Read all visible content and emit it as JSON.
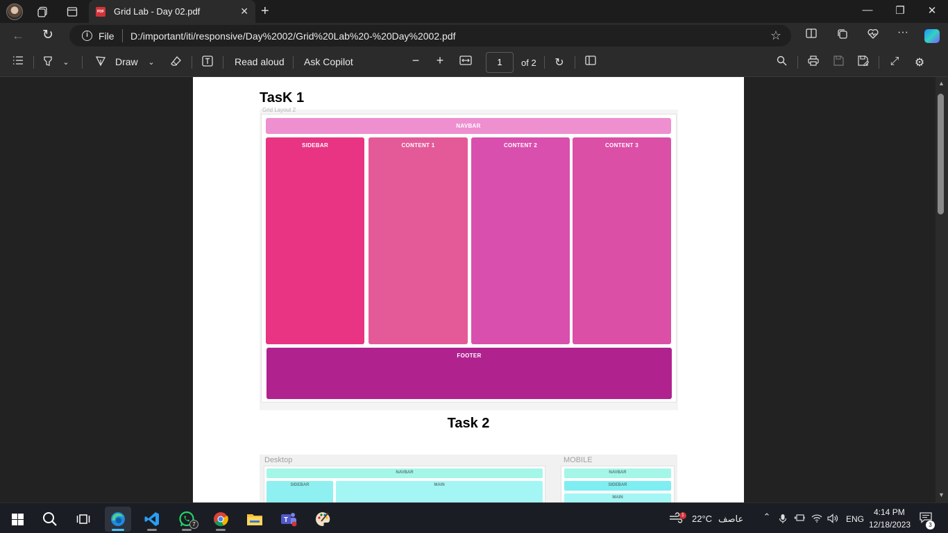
{
  "browser": {
    "tab": {
      "title": "Grid Lab - Day 02.pdf",
      "badge": "PDF"
    },
    "address": {
      "scheme_label": "File",
      "url": "D:/important/iti/responsive/Day%2002/Grid%20Lab%20-%20Day%2002.pdf"
    }
  },
  "pdf_toolbar": {
    "draw_label": "Draw",
    "read_aloud_label": "Read aloud",
    "ask_copilot_label": "Ask Copilot",
    "page_current": "1",
    "page_total_label": "of 2"
  },
  "document": {
    "task1_title": "TasK 1",
    "task1_caption": "Grid Layout 2",
    "task1_grid": {
      "navbar": "NAVBAR",
      "sidebar": "SIDEBAR",
      "content1": "CONTENT 1",
      "content2": "CONTENT 2",
      "content3": "CONTENT 3",
      "footer": "FOOTER"
    },
    "task2_title": "Task 2",
    "task2_desktop_label": "Desktop",
    "task2_mobile_label": "MOBILE",
    "task2_desktop": {
      "navbar": "NAVBAR",
      "sidebar": "SIDEBAR",
      "main": "MAIN"
    },
    "task2_mobile": {
      "navbar": "NAVBAR",
      "sidebar": "SIDEBAR",
      "main": "MAIN"
    }
  },
  "taskbar": {
    "whatsapp_badge": "7",
    "weather_temp": "22°C",
    "weather_desc": "عاصف",
    "weather_alert": "1",
    "language": "ENG",
    "time": "4:14 PM",
    "date": "12/18/2023",
    "notifications": "3"
  },
  "colors": {
    "navbar": "#ee8fd0",
    "sidebar": "#e83482",
    "content1": "#e45a98",
    "content2": "#d94fae",
    "content3": "#db4fa6",
    "footer": "#b0238f",
    "cyan": "#a4f6f4"
  }
}
